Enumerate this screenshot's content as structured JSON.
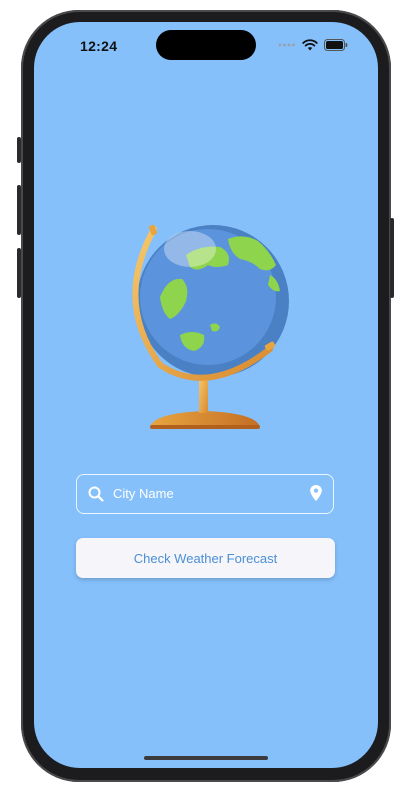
{
  "status_bar": {
    "time": "12:24"
  },
  "search": {
    "placeholder": "City Name",
    "value": ""
  },
  "actions": {
    "forecast_label": "Check Weather Forecast"
  },
  "icons": {
    "search": "search-icon",
    "location": "location-pin-icon",
    "wifi": "wifi-icon",
    "battery": "battery-icon",
    "signal": "signal-icon"
  },
  "colors": {
    "background": "#85c0fb",
    "button_bg": "#f5f5fa",
    "button_text": "#4b8fd6",
    "field_border": "#ffffff"
  }
}
